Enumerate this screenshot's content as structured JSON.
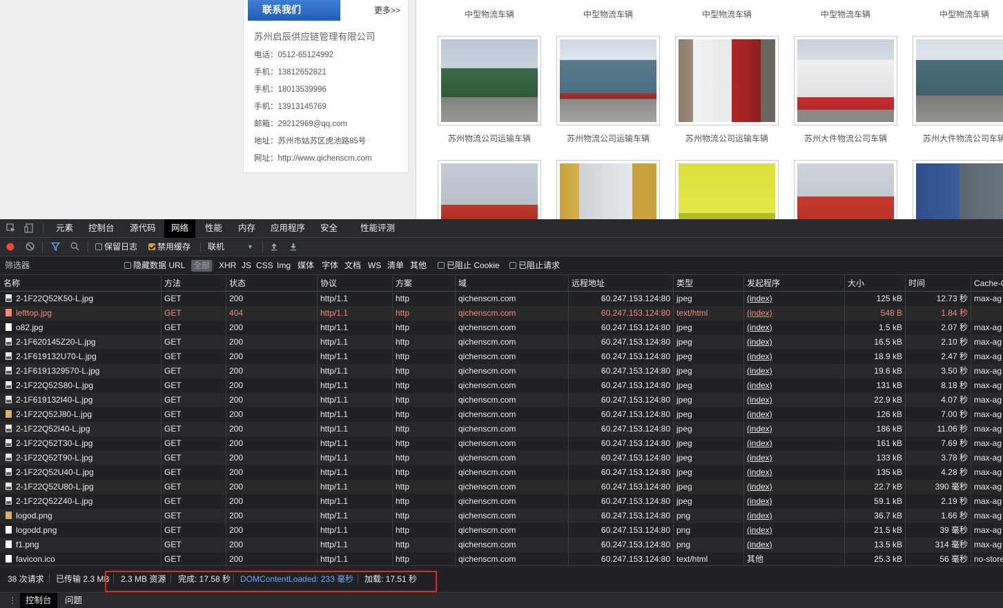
{
  "site": {
    "contact": {
      "header": "联系我们",
      "more": "更多>>",
      "company": "苏州启辰供应链管理有限公司",
      "lines": [
        "电话：0512-65124992",
        "手机：13812652821",
        "手机：18013539996",
        "手机：13913145769",
        "邮箱：29212969@qq.com",
        "地址：苏州市姑苏区虎池路85号",
        "网址：http://www.qichenscm.com"
      ]
    },
    "gallery": {
      "row1_captions": [
        "中型物流车辆",
        "中型物流车辆",
        "中型物流车辆",
        "中型物流车辆",
        "中型物流车辆"
      ],
      "row2_captions": [
        "苏州物流公司运输车辆",
        "苏州物流公司运输车辆",
        "苏州物流公司运输车辆",
        "苏州大件物流公司车辆",
        "苏州大件物流公司车辆"
      ]
    }
  },
  "devtools": {
    "tabs": [
      "元素",
      "控制台",
      "源代码",
      "网络",
      "性能",
      "内存",
      "应用程序",
      "安全",
      "性能评测"
    ],
    "active_tab": "网络",
    "toolbar": {
      "preserve_log": "保留日志",
      "disable_cache": "禁用缓存",
      "throttle": "联机"
    },
    "filterbar": {
      "filter_placeholder": "筛选器",
      "hide_data_urls": "隐藏数据 URL",
      "all": "全部",
      "types": [
        "XHR",
        "JS",
        "CSS",
        "Img",
        "媒体",
        "字体",
        "文档",
        "WS",
        "清单",
        "其他"
      ],
      "blocked_cookies": "已阻止 Cookie",
      "blocked_requests": "已阻止请求"
    },
    "columns": [
      "名称",
      "方法",
      "状态",
      "协议",
      "方案",
      "域",
      "远程地址",
      "类型",
      "发起程序",
      "大小",
      "时间",
      "Cache-C"
    ],
    "rows": [
      {
        "name": "2-1F22Q52K50-L.jpg",
        "method": "GET",
        "status": "200",
        "protocol": "http/1.1",
        "scheme": "http",
        "domain": "qichenscm.com",
        "remote": "60.247.153.124:80",
        "type": "jpeg",
        "initiator": "(index)",
        "size": "125 kB",
        "time": "12.73 秒",
        "cache": "max-ag",
        "icon": "img"
      },
      {
        "name": "lefttop.jpg",
        "method": "GET",
        "status": "404",
        "protocol": "http/1.1",
        "scheme": "http",
        "domain": "qichenscm.com",
        "remote": "60.247.153.124:80",
        "type": "text/html",
        "initiator": "(index)",
        "size": "548 B",
        "time": "1.84 秒",
        "cache": "",
        "icon": "err"
      },
      {
        "name": "o82.jpg",
        "method": "GET",
        "status": "200",
        "protocol": "http/1.1",
        "scheme": "http",
        "domain": "qichenscm.com",
        "remote": "60.247.153.124:80",
        "type": "jpeg",
        "initiator": "(index)",
        "size": "1.5 kB",
        "time": "2.07 秒",
        "cache": "max-ag",
        "icon": "doc"
      },
      {
        "name": "2-1F620145Z20-L.jpg",
        "method": "GET",
        "status": "200",
        "protocol": "http/1.1",
        "scheme": "http",
        "domain": "qichenscm.com",
        "remote": "60.247.153.124:80",
        "type": "jpeg",
        "initiator": "(index)",
        "size": "16.5 kB",
        "time": "2.10 秒",
        "cache": "max-ag",
        "icon": "img"
      },
      {
        "name": "2-1F619132U70-L.jpg",
        "method": "GET",
        "status": "200",
        "protocol": "http/1.1",
        "scheme": "http",
        "domain": "qichenscm.com",
        "remote": "60.247.153.124:80",
        "type": "jpeg",
        "initiator": "(index)",
        "size": "18.9 kB",
        "time": "2.47 秒",
        "cache": "max-ag",
        "icon": "img"
      },
      {
        "name": "2-1F6191329570-L.jpg",
        "method": "GET",
        "status": "200",
        "protocol": "http/1.1",
        "scheme": "http",
        "domain": "qichenscm.com",
        "remote": "60.247.153.124:80",
        "type": "jpeg",
        "initiator": "(index)",
        "size": "19.6 kB",
        "time": "3.50 秒",
        "cache": "max-ag",
        "icon": "img"
      },
      {
        "name": "2-1F22Q52S80-L.jpg",
        "method": "GET",
        "status": "200",
        "protocol": "http/1.1",
        "scheme": "http",
        "domain": "qichenscm.com",
        "remote": "60.247.153.124:80",
        "type": "jpeg",
        "initiator": "(index)",
        "size": "131 kB",
        "time": "8.18 秒",
        "cache": "max-ag",
        "icon": "img"
      },
      {
        "name": "2-1F619132I40-L.jpg",
        "method": "GET",
        "status": "200",
        "protocol": "http/1.1",
        "scheme": "http",
        "domain": "qichenscm.com",
        "remote": "60.247.153.124:80",
        "type": "jpeg",
        "initiator": "(index)",
        "size": "22.9 kB",
        "time": "4.07 秒",
        "cache": "max-ag",
        "icon": "img"
      },
      {
        "name": "2-1F22Q52J80-L.jpg",
        "method": "GET",
        "status": "200",
        "protocol": "http/1.1",
        "scheme": "http",
        "domain": "qichenscm.com",
        "remote": "60.247.153.124:80",
        "type": "jpeg",
        "initiator": "(index)",
        "size": "126 kB",
        "time": "7.00 秒",
        "cache": "max-ag",
        "icon": "png"
      },
      {
        "name": "2-1F22Q52I40-L.jpg",
        "method": "GET",
        "status": "200",
        "protocol": "http/1.1",
        "scheme": "http",
        "domain": "qichenscm.com",
        "remote": "60.247.153.124:80",
        "type": "jpeg",
        "initiator": "(index)",
        "size": "186 kB",
        "time": "11.06 秒",
        "cache": "max-ag",
        "icon": "img"
      },
      {
        "name": "2-1F22Q52T30-L.jpg",
        "method": "GET",
        "status": "200",
        "protocol": "http/1.1",
        "scheme": "http",
        "domain": "qichenscm.com",
        "remote": "60.247.153.124:80",
        "type": "jpeg",
        "initiator": "(index)",
        "size": "161 kB",
        "time": "7.69 秒",
        "cache": "max-ag",
        "icon": "img"
      },
      {
        "name": "2-1F22Q52T90-L.jpg",
        "method": "GET",
        "status": "200",
        "protocol": "http/1.1",
        "scheme": "http",
        "domain": "qichenscm.com",
        "remote": "60.247.153.124:80",
        "type": "jpeg",
        "initiator": "(index)",
        "size": "133 kB",
        "time": "3.78 秒",
        "cache": "max-ag",
        "icon": "img"
      },
      {
        "name": "2-1F22Q52U40-L.jpg",
        "method": "GET",
        "status": "200",
        "protocol": "http/1.1",
        "scheme": "http",
        "domain": "qichenscm.com",
        "remote": "60.247.153.124:80",
        "type": "jpeg",
        "initiator": "(index)",
        "size": "135 kB",
        "time": "4.28 秒",
        "cache": "max-ag",
        "icon": "img"
      },
      {
        "name": "2-1F22Q52U80-L.jpg",
        "method": "GET",
        "status": "200",
        "protocol": "http/1.1",
        "scheme": "http",
        "domain": "qichenscm.com",
        "remote": "60.247.153.124:80",
        "type": "jpeg",
        "initiator": "(index)",
        "size": "22.7 kB",
        "time": "390 毫秒",
        "cache": "max-ag",
        "icon": "img"
      },
      {
        "name": "2-1F22Q52Z40-L.jpg",
        "method": "GET",
        "status": "200",
        "protocol": "http/1.1",
        "scheme": "http",
        "domain": "qichenscm.com",
        "remote": "60.247.153.124:80",
        "type": "jpeg",
        "initiator": "(index)",
        "size": "59.1 kB",
        "time": "2.19 秒",
        "cache": "max-ag",
        "icon": "img"
      },
      {
        "name": "logod.png",
        "method": "GET",
        "status": "200",
        "protocol": "http/1.1",
        "scheme": "http",
        "domain": "qichenscm.com",
        "remote": "60.247.153.124:80",
        "type": "png",
        "initiator": "(index)",
        "size": "36.7 kB",
        "time": "1.66 秒",
        "cache": "max-ag",
        "icon": "png"
      },
      {
        "name": "logodd.png",
        "method": "GET",
        "status": "200",
        "protocol": "http/1.1",
        "scheme": "http",
        "domain": "qichenscm.com",
        "remote": "60.247.153.124:80",
        "type": "png",
        "initiator": "(index)",
        "size": "21.5 kB",
        "time": "39 毫秒",
        "cache": "max-ag",
        "icon": "doc"
      },
      {
        "name": "f1.png",
        "method": "GET",
        "status": "200",
        "protocol": "http/1.1",
        "scheme": "http",
        "domain": "qichenscm.com",
        "remote": "60.247.153.124:80",
        "type": "png",
        "initiator": "(index)",
        "size": "13.5 kB",
        "time": "314 毫秒",
        "cache": "max-ag",
        "icon": "doc"
      },
      {
        "name": "favicon.ico",
        "method": "GET",
        "status": "200",
        "protocol": "http/1.1",
        "scheme": "http",
        "domain": "qichenscm.com",
        "remote": "60.247.153.124:80",
        "type": "text/html",
        "initiator": "其他",
        "size": "25.3 kB",
        "time": "56 毫秒",
        "cache": "no-store",
        "icon": "doc"
      }
    ],
    "status": {
      "requests": "38 次请求",
      "transferred": "已传输 2.3 MB",
      "resources": "2.3 MB 资源",
      "finish": "完成: 17.58 秒",
      "dcl": "DOMContentLoaded: 233 毫秒",
      "load": "加载: 17.51 秒"
    },
    "drawer_tabs": [
      "控制台",
      "问题"
    ]
  }
}
